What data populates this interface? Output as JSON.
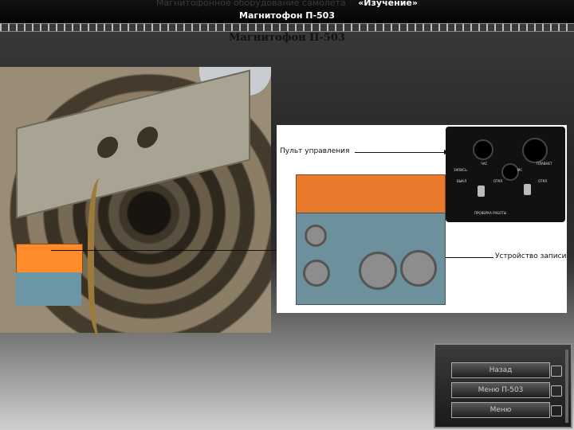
{
  "header": {
    "course_text": "Магнитофонное оборудование самолёта",
    "mode_label": "«Изучение»",
    "section_title": "Магнитофон П-503"
  },
  "main": {
    "title": "Магнитофон П-503"
  },
  "figure": {
    "control_panel_label": "Пульт управления",
    "recorder_label": "Устройство записи",
    "panel_markings": [
      "ЗАПИСЬ",
      "ЧАС",
      "МС",
      "ПЛАВНЕТ",
      "ВЫКЛ",
      "ОТКЛ",
      "ОТКЛ",
      "ПРОВЕРКА РАБОТЫ"
    ]
  },
  "nav": {
    "buttons": [
      {
        "label": "Назад"
      },
      {
        "label": "Меню П-503"
      },
      {
        "label": "Меню"
      }
    ]
  }
}
